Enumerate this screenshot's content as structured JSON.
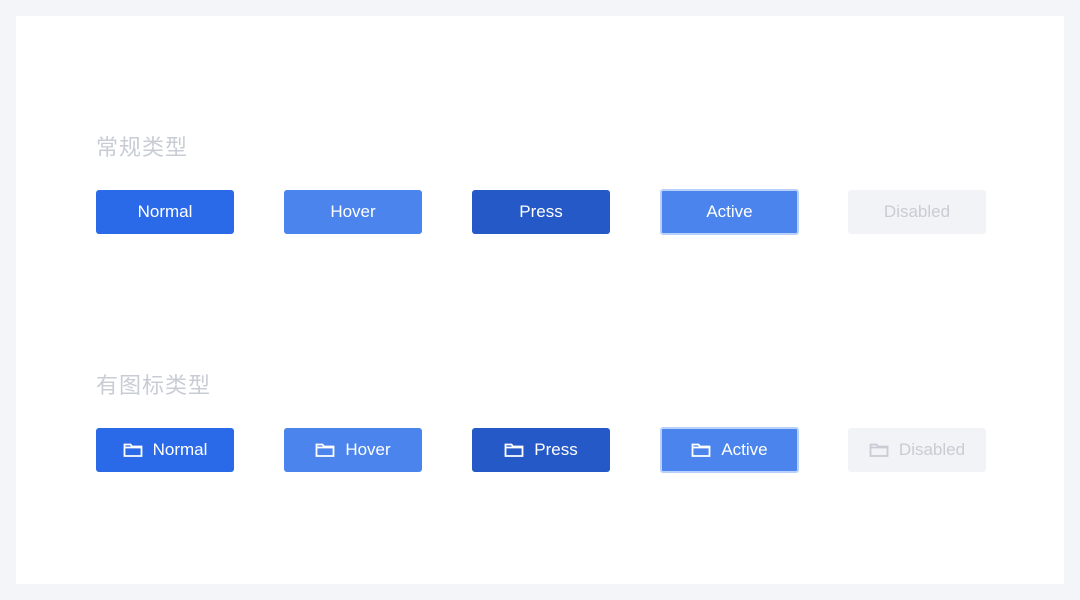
{
  "sections": [
    {
      "title": "常规类型",
      "buttons": [
        {
          "label": "Normal",
          "state": "normal"
        },
        {
          "label": "Hover",
          "state": "hover"
        },
        {
          "label": "Press",
          "state": "press"
        },
        {
          "label": "Active",
          "state": "active"
        },
        {
          "label": "Disabled",
          "state": "disabled"
        }
      ]
    },
    {
      "title": "有图标类型",
      "icon": "folder-icon",
      "buttons": [
        {
          "label": "Normal",
          "state": "normal"
        },
        {
          "label": "Hover",
          "state": "hover"
        },
        {
          "label": "Press",
          "state": "press"
        },
        {
          "label": "Active",
          "state": "active"
        },
        {
          "label": "Disabled",
          "state": "disabled"
        }
      ]
    }
  ],
  "colors": {
    "normal": "#2a6ae8",
    "hover": "#4a84ec",
    "press": "#2459c7",
    "active_border": "#b9d0fa",
    "disabled_bg": "#f1f3f6",
    "disabled_text": "#c8ccd4"
  }
}
